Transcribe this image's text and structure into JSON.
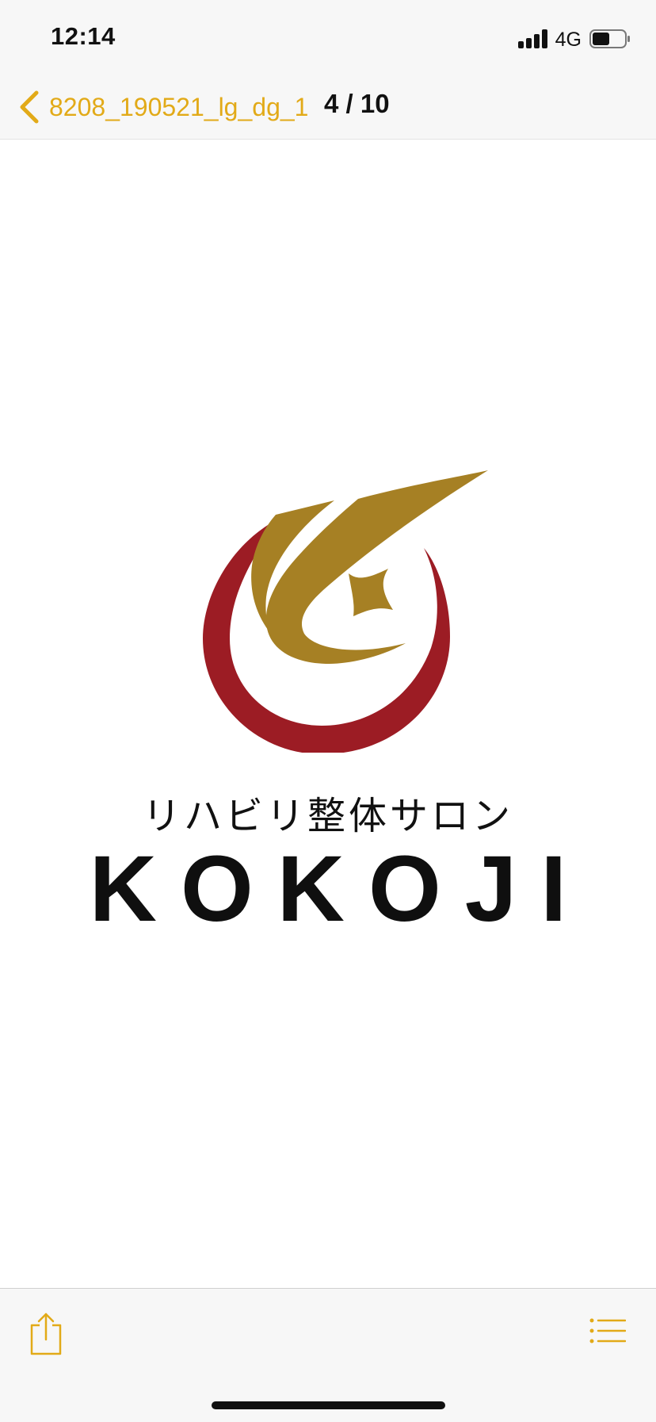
{
  "status_bar": {
    "time": "12:14",
    "network": "4G",
    "battery_fraction": 0.55
  },
  "nav": {
    "back_label": "8208_190521_lg_dg_1",
    "page_counter": "4 / 10"
  },
  "logo": {
    "subtitle": "リハビリ整体サロン",
    "wordmark": "KOKOJI"
  },
  "colors": {
    "accent": "#e2aa18",
    "logo_red": "#9c1c24",
    "logo_gold": "#a68024"
  },
  "icons": {
    "back": "chevron-left-icon",
    "share": "share-icon",
    "list": "list-icon"
  }
}
